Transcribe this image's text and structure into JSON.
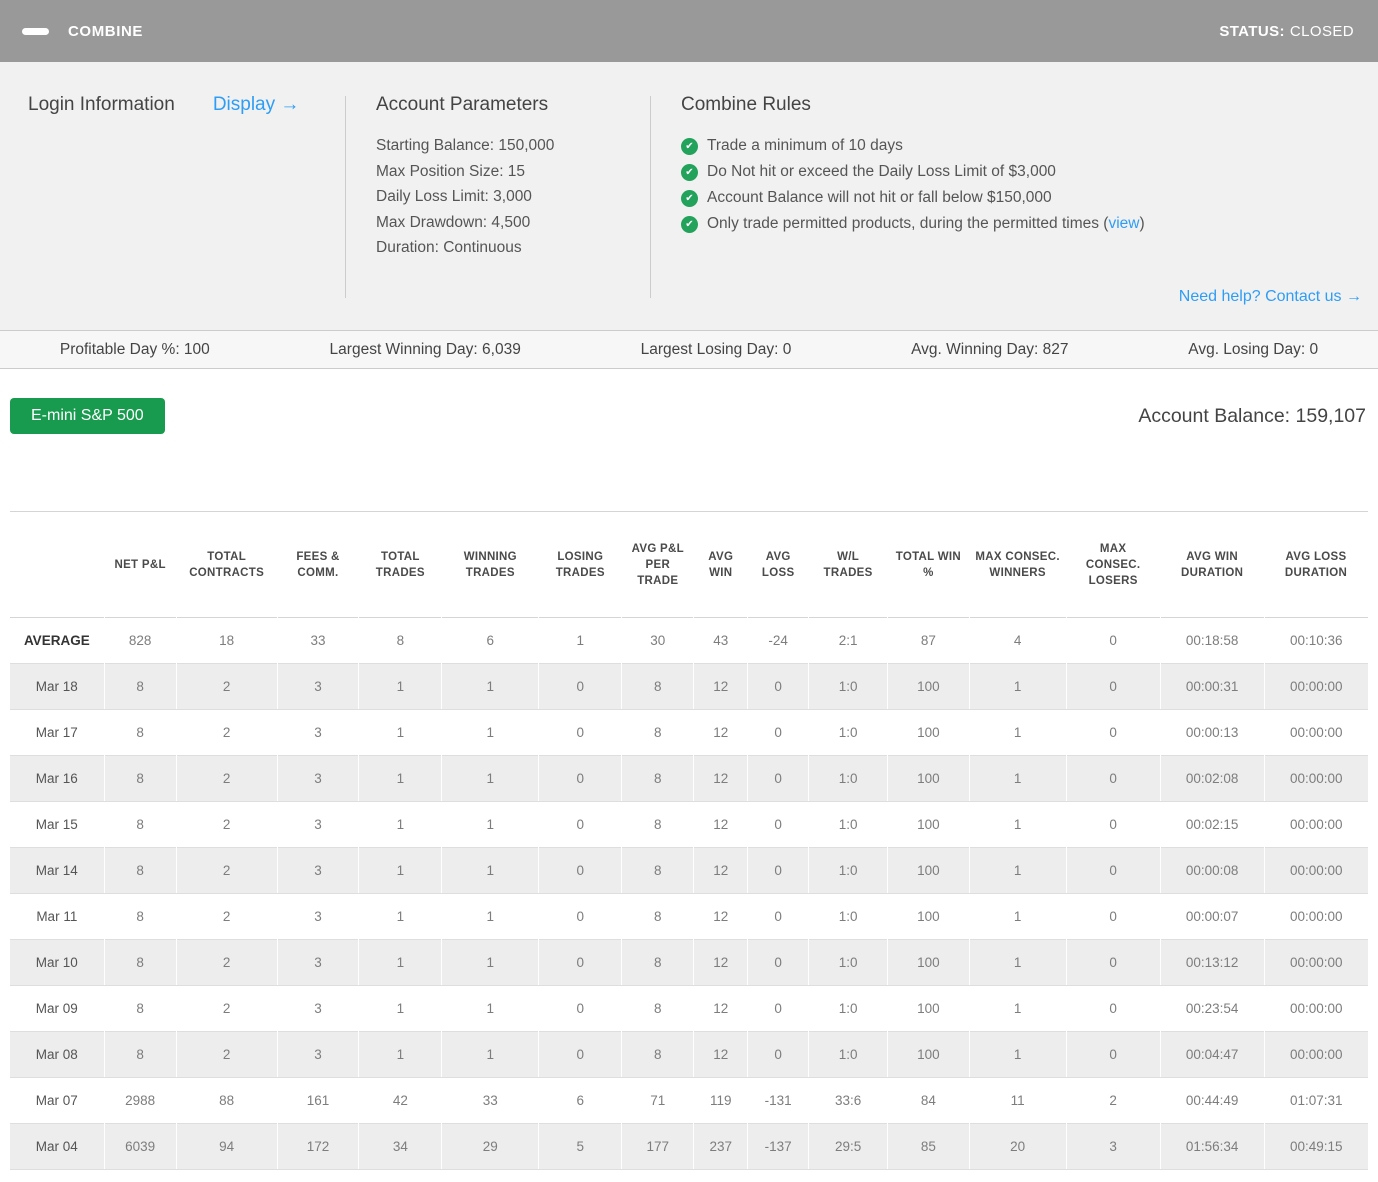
{
  "header": {
    "title": "COMBINE",
    "status_label": "STATUS:",
    "status_value": "CLOSED"
  },
  "panel": {
    "login": {
      "heading": "Login Information",
      "display_link": "Display →"
    },
    "account_parameters": {
      "heading": "Account Parameters",
      "lines": [
        "Starting Balance: 150,000",
        "Max Position Size: 15",
        "Daily Loss Limit: 3,000",
        "Max Drawdown: 4,500",
        "Duration: Continuous"
      ]
    },
    "combine_rules": {
      "heading": "Combine Rules",
      "rules": [
        {
          "text": "Trade a minimum of 10 days"
        },
        {
          "text": "Do Not hit or exceed the Daily Loss Limit of $3,000"
        },
        {
          "text": "Account Balance will not hit or fall below $150,000"
        },
        {
          "text": "Only trade permitted products, during the permitted times (",
          "link_text": "view",
          "suffix": ")"
        }
      ]
    },
    "help_link": "Need help? Contact us →"
  },
  "stats": [
    "Profitable Day %: 100",
    "Largest Winning Day: 6,039",
    "Largest Losing Day: 0",
    "Avg. Winning Day: 827",
    "Avg. Losing Day: 0"
  ],
  "account": {
    "product_button": "E-mini S&P 500",
    "balance": "Account Balance: 159,107"
  },
  "table": {
    "columns": [
      "",
      "NET P&L",
      "TOTAL CONTRACTS",
      "FEES & COMM.",
      "TOTAL TRADES",
      "WINNING TRADES",
      "LOSING TRADES",
      "AVG P&L PER TRADE",
      "AVG WIN",
      "AVG LOSS",
      "W/L TRADES",
      "TOTAL WIN %",
      "MAX CONSEC. WINNERS",
      "MAX CONSEC. LOSERS",
      "AVG WIN DURATION",
      "AVG LOSS DURATION"
    ],
    "rows": [
      {
        "label": "AVERAGE",
        "values": [
          "828",
          "18",
          "33",
          "8",
          "6",
          "1",
          "30",
          "43",
          "-24",
          "2:1",
          "87",
          "4",
          "0",
          "00:18:58",
          "00:10:36"
        ]
      },
      {
        "label": "Mar 18",
        "values": [
          "8",
          "2",
          "3",
          "1",
          "1",
          "0",
          "8",
          "12",
          "0",
          "1:0",
          "100",
          "1",
          "0",
          "00:00:31",
          "00:00:00"
        ]
      },
      {
        "label": "Mar 17",
        "values": [
          "8",
          "2",
          "3",
          "1",
          "1",
          "0",
          "8",
          "12",
          "0",
          "1:0",
          "100",
          "1",
          "0",
          "00:00:13",
          "00:00:00"
        ]
      },
      {
        "label": "Mar 16",
        "values": [
          "8",
          "2",
          "3",
          "1",
          "1",
          "0",
          "8",
          "12",
          "0",
          "1:0",
          "100",
          "1",
          "0",
          "00:02:08",
          "00:00:00"
        ]
      },
      {
        "label": "Mar 15",
        "values": [
          "8",
          "2",
          "3",
          "1",
          "1",
          "0",
          "8",
          "12",
          "0",
          "1:0",
          "100",
          "1",
          "0",
          "00:02:15",
          "00:00:00"
        ]
      },
      {
        "label": "Mar 14",
        "values": [
          "8",
          "2",
          "3",
          "1",
          "1",
          "0",
          "8",
          "12",
          "0",
          "1:0",
          "100",
          "1",
          "0",
          "00:00:08",
          "00:00:00"
        ]
      },
      {
        "label": "Mar 11",
        "values": [
          "8",
          "2",
          "3",
          "1",
          "1",
          "0",
          "8",
          "12",
          "0",
          "1:0",
          "100",
          "1",
          "0",
          "00:00:07",
          "00:00:00"
        ]
      },
      {
        "label": "Mar 10",
        "values": [
          "8",
          "2",
          "3",
          "1",
          "1",
          "0",
          "8",
          "12",
          "0",
          "1:0",
          "100",
          "1",
          "0",
          "00:13:12",
          "00:00:00"
        ]
      },
      {
        "label": "Mar 09",
        "values": [
          "8",
          "2",
          "3",
          "1",
          "1",
          "0",
          "8",
          "12",
          "0",
          "1:0",
          "100",
          "1",
          "0",
          "00:23:54",
          "00:00:00"
        ]
      },
      {
        "label": "Mar 08",
        "values": [
          "8",
          "2",
          "3",
          "1",
          "1",
          "0",
          "8",
          "12",
          "0",
          "1:0",
          "100",
          "1",
          "0",
          "00:04:47",
          "00:00:00"
        ]
      },
      {
        "label": "Mar 07",
        "values": [
          "2988",
          "88",
          "161",
          "42",
          "33",
          "6",
          "71",
          "119",
          "-131",
          "33:6",
          "84",
          "11",
          "2",
          "00:44:49",
          "01:07:31"
        ]
      },
      {
        "label": "Mar 04",
        "values": [
          "6039",
          "94",
          "172",
          "34",
          "29",
          "5",
          "177",
          "237",
          "-137",
          "29:5",
          "85",
          "20",
          "3",
          "01:56:34",
          "00:49:15"
        ]
      }
    ]
  },
  "colors": {
    "titlebar_bg": "#999999",
    "panel_bg": "#f1f1f1",
    "link_blue": "#2e9df5",
    "check_green": "#23a25c",
    "button_green": "#189b4e",
    "stripe_gray": "#ededed"
  }
}
